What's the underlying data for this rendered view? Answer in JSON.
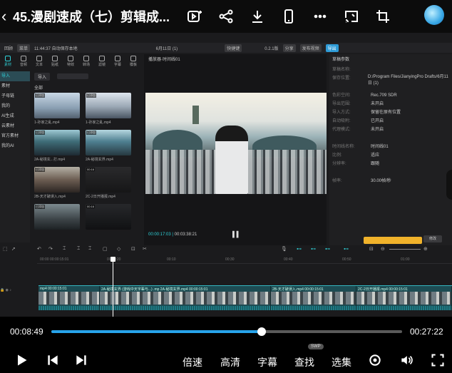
{
  "header": {
    "back_glyph": "‹",
    "title": "45.漫剧速成（七）剪辑成...",
    "icons": [
      "video-plus-icon",
      "share-icon",
      "download-icon",
      "phone-icon",
      "more-icon",
      "screen-cast-icon",
      "crop-icon"
    ]
  },
  "editor": {
    "menubar": {
      "items": [
        "回顾",
        "菜单",
        "11:44:37 自动保存本地",
        "6月11日 (1)",
        "快捷键",
        "0.2.1版",
        "分享",
        "发布视频",
        "导出"
      ]
    },
    "toolbar_tabs": [
      "素材",
      "音频",
      "文本",
      "贴纸",
      "特效",
      "转场",
      "滤镜",
      "字幕",
      "模板"
    ],
    "sidenav": [
      "导入",
      "素材",
      "子母链",
      "我的",
      "AI生成",
      "云素材",
      "官方素材",
      "我的AI"
    ],
    "media": {
      "import_label": "导入",
      "all_label": "全部",
      "clips": [
        {
          "name": "1-孙家之乱.mp4",
          "tag": "已添加"
        },
        {
          "name": "1-孙家之乱.mp4",
          "tag": "已添加"
        },
        {
          "name": "2A-秘境玄...打.mp4",
          "tag": "已添加"
        },
        {
          "name": "2A-秘境玄界.mp4",
          "tag": "已添加"
        },
        {
          "name": "2B-天才破误入.mp4",
          "tag": "已添加"
        },
        {
          "name": "2C-2日开播报.mp4",
          "tag": "00:16"
        },
        {
          "name": "",
          "tag": "已添加"
        },
        {
          "name": "",
          "tag": "00:16"
        }
      ]
    },
    "player": {
      "title": "播放器·时间线01",
      "current_time": "00:00:17:03",
      "total_time": "00:03:38:21"
    },
    "props": {
      "title": "草稿参数",
      "rows": [
        {
          "k": "草稿名称:",
          "v": ""
        },
        {
          "k": "保存位置:",
          "v": "D:/Program Files/JianyingPro Drafts/6月11日 (1)"
        },
        {
          "k": "色彩空间:",
          "v": "Rec.709 SDR"
        },
        {
          "k": "导出范围:",
          "v": "未开启"
        },
        {
          "k": "导入方式:",
          "v": "保留在原有位置"
        },
        {
          "k": "自动吸附:",
          "v": "已开启"
        },
        {
          "k": "代理模式:",
          "v": "未开启"
        },
        {
          "k": "",
          "v": ""
        },
        {
          "k": "时间线名称:",
          "v": "时间线01"
        },
        {
          "k": "比例:",
          "v": "适应"
        },
        {
          "k": "分辨率:",
          "v": "跟随"
        },
        {
          "k": "",
          "v": ""
        },
        {
          "k": "帧率:",
          "v": "30.00帧/秒"
        }
      ],
      "modify_label": "修改"
    },
    "ruler": [
      "00:00",
      "00:00:15:01",
      "00:00:20",
      "00:10",
      "00:30",
      "00:40",
      "00:50",
      "01:00"
    ],
    "track": {
      "segments": [
        {
          "label": "mp4  00:00:15:01",
          "width": 86
        },
        {
          "label": "2A-秘境玄界 (游戏中天字辈与...) .mp  2A-秘境玄界.mp4  00:00:15:01",
          "width": 240
        },
        {
          "label": "2B-天才破误入.mp4  00:00:15:01",
          "width": 120
        },
        {
          "label": "2C-2日开播报.mp4  00:00:15:01",
          "width": 134
        }
      ]
    }
  },
  "controls": {
    "current_time": "00:08:49",
    "total_time": "00:27:22",
    "progress": 0.6,
    "speed_label": "倍速",
    "quality_label": "高清",
    "subtitle_label": "字幕",
    "search_label": "查找",
    "swp_badge": "SWP",
    "episodes_label": "选集"
  }
}
